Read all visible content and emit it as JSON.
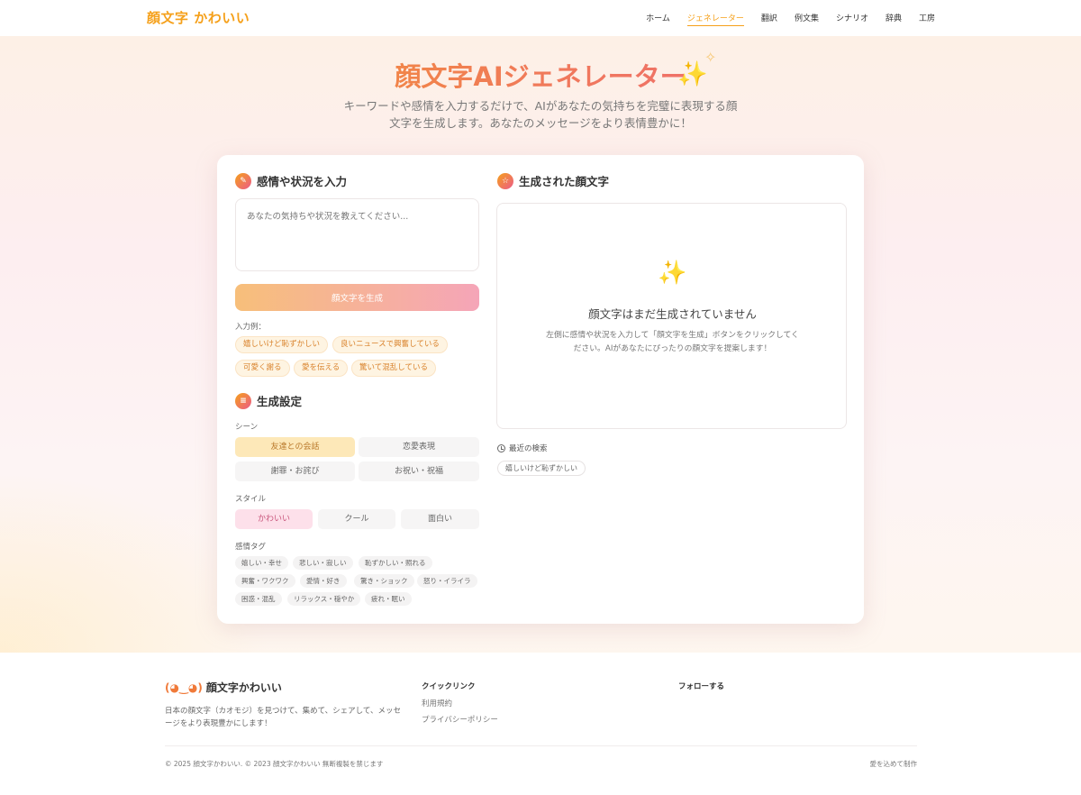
{
  "header": {
    "logo": "顔文字 かわいい",
    "nav": [
      "ホーム",
      "ジェネレーター",
      "翻訳",
      "例文集",
      "シナリオ",
      "辞典",
      "工房"
    ],
    "active_nav": "ジェネレーター"
  },
  "hero": {
    "title": "顔文字AIジェネレーター",
    "subtitle": "キーワードや感情を入力するだけで、AIがあなたの気持ちを完璧に表現する顔文字を生成します。あなたのメッセージをより表情豊かに！"
  },
  "input_section": {
    "heading": "感情や状況を入力",
    "placeholder": "あなたの気持ちや状況を教えてください...",
    "generate_button": "顔文字を生成",
    "examples_label": "入力例：",
    "examples": [
      "嬉しいけど恥ずかしい",
      "良いニュースで興奮している",
      "可愛く謝る",
      "愛を伝える",
      "驚いて混乱している"
    ]
  },
  "settings": {
    "heading": "生成設定",
    "scene_label": "シーン",
    "scenes": [
      "友達との会話",
      "恋愛表現",
      "謝罪・お詫び",
      "お祝い・祝福"
    ],
    "selected_scene": "友達との会話",
    "style_label": "スタイル",
    "styles": [
      "かわいい",
      "クール",
      "面白い"
    ],
    "selected_style": "かわいい",
    "tags_label": "感情タグ",
    "tags": [
      "嬉しい・幸せ",
      "悲しい・寂しい",
      "恥ずかしい・照れる",
      "興奮・ワクワク",
      "愛情・好き",
      "驚き・ショック",
      "怒り・イライラ",
      "困惑・混乱",
      "リラックス・穏やか",
      "疲れ・眠い"
    ]
  },
  "result": {
    "heading": "生成された顔文字",
    "empty_title": "顔文字はまだ生成されていません",
    "empty_desc": "左側に感情や状況を入力して「顔文字を生成」ボタンをクリックしてください。AIがあなたにぴったりの顔文字を提案します！",
    "recent_label": "最近の検索",
    "recent": [
      "嬉しいけど恥ずかしい"
    ]
  },
  "footer": {
    "brand_face": "(◕‿◕)",
    "brand_name": "顔文字かわいい",
    "desc": "日本の顔文字（カオモジ）を見つけて、集めて、シェアして、メッセージをより表現豊かにします！",
    "quick_links_title": "クイックリンク",
    "quick_links": [
      "利用規約",
      "プライバシーポリシー"
    ],
    "follow_title": "フォローする",
    "copyright": "© 2025 顔文字かわいい. © 2023 顔文字かわいい 無断複製を禁じます",
    "made_with": "愛を込めて制作"
  },
  "colors": {
    "accent": "#f5a01a",
    "pink": "#ec5b8a"
  }
}
